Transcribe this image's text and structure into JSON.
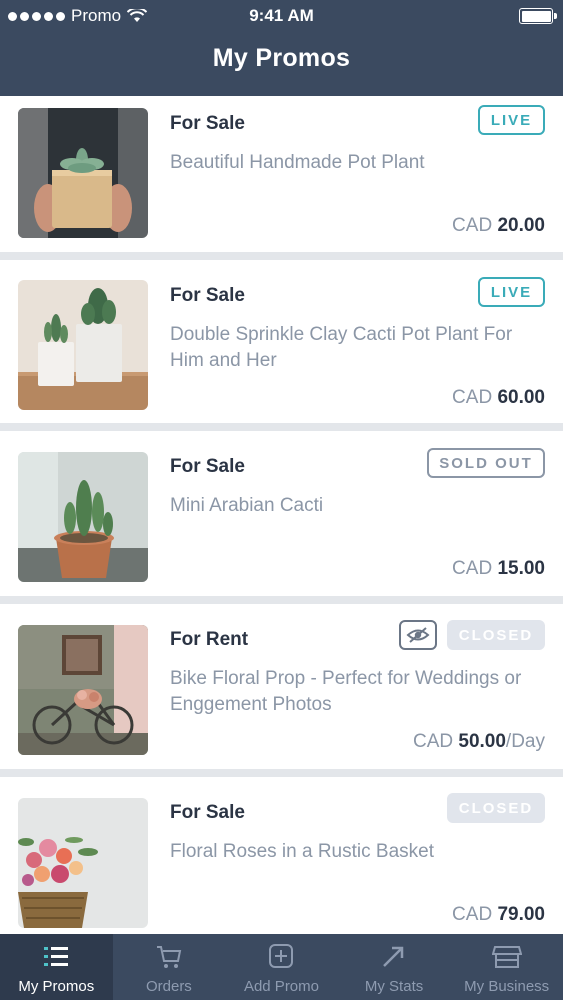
{
  "status_bar": {
    "carrier": "Promo",
    "time": "9:41 AM"
  },
  "header": {
    "title": "My Promos"
  },
  "promos": [
    {
      "type": "For Sale",
      "title": "Beautiful Handmade Pot Plant",
      "currency": "CAD",
      "price": "20.00",
      "unit": "",
      "status": "LIVE",
      "image": "potted-succulent-in-wood-cube"
    },
    {
      "type": "For Sale",
      "title": "Double Sprinkle Clay Cacti Pot Plant For Him and Her",
      "currency": "CAD",
      "price": "60.00",
      "unit": "",
      "status": "LIVE",
      "image": "two-cacti-in-clay-pots"
    },
    {
      "type": "For Sale",
      "title": "Mini Arabian Cacti",
      "currency": "CAD",
      "price": "15.00",
      "unit": "",
      "status": "SOLD OUT",
      "image": "small-cactus-in-terracotta-pot"
    },
    {
      "type": "For Rent",
      "title": "Bike Floral Prop - Perfect for Weddings or Enggement Photos",
      "currency": "CAD",
      "price": "50.00",
      "unit": "/Day",
      "status": "CLOSED",
      "hidden_icon": "eye-off-icon",
      "image": "vintage-bicycle-with-flowers"
    },
    {
      "type": "For Sale",
      "title": "Floral Roses in a Rustic Basket",
      "currency": "CAD",
      "price": "79.00",
      "unit": "",
      "status": "CLOSED",
      "image": "roses-in-wicker-basket"
    }
  ],
  "tabs": [
    {
      "label": "My Promos",
      "icon": "list-icon",
      "active": true
    },
    {
      "label": "Orders",
      "icon": "cart-icon",
      "active": false
    },
    {
      "label": "Add Promo",
      "icon": "plus-square-icon",
      "active": false
    },
    {
      "label": "My Stats",
      "icon": "trend-arrow-icon",
      "active": false
    },
    {
      "label": "My Business",
      "icon": "storefront-icon",
      "active": false
    }
  ],
  "colors": {
    "header": "#3b4a60",
    "accent_live": "#3aabb8",
    "text_dark": "#2b3444",
    "text_muted": "#8b96a6"
  }
}
